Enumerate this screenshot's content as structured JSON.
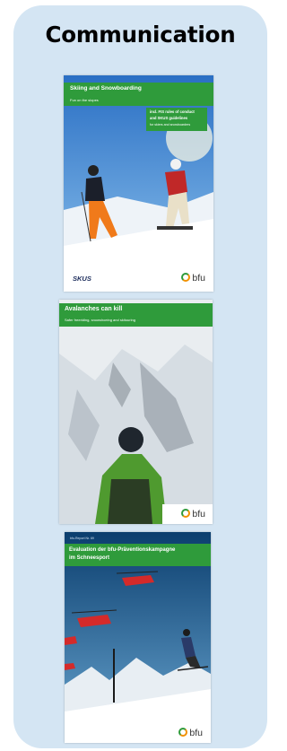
{
  "panel": {
    "title": "Communication"
  },
  "covers": [
    {
      "title": "Skiing and Snowboarding",
      "subtitle": "Fun on the slopes",
      "badge_line1": "incl. FIS rules of conduct",
      "badge_line2": "and SKUS guidelines",
      "badge_line3": "for skiers and snowboarders",
      "logo_left": "SKUS",
      "logo_right": "bfu"
    },
    {
      "title": "Avalanches can kill",
      "subtitle": "Safer freeriding, snowshoeing and skitouring",
      "logo_right": "bfu"
    },
    {
      "kicker": "bfu-Report Nr. 69",
      "title_line1": "Evaluation der bfu-Präventionskampagne",
      "title_line2": "im Schneesport",
      "logo_right": "bfu"
    }
  ],
  "colors": {
    "panel_bg": "#d4e5f3",
    "green": "#2f9b3b",
    "accent": "#f29100"
  }
}
